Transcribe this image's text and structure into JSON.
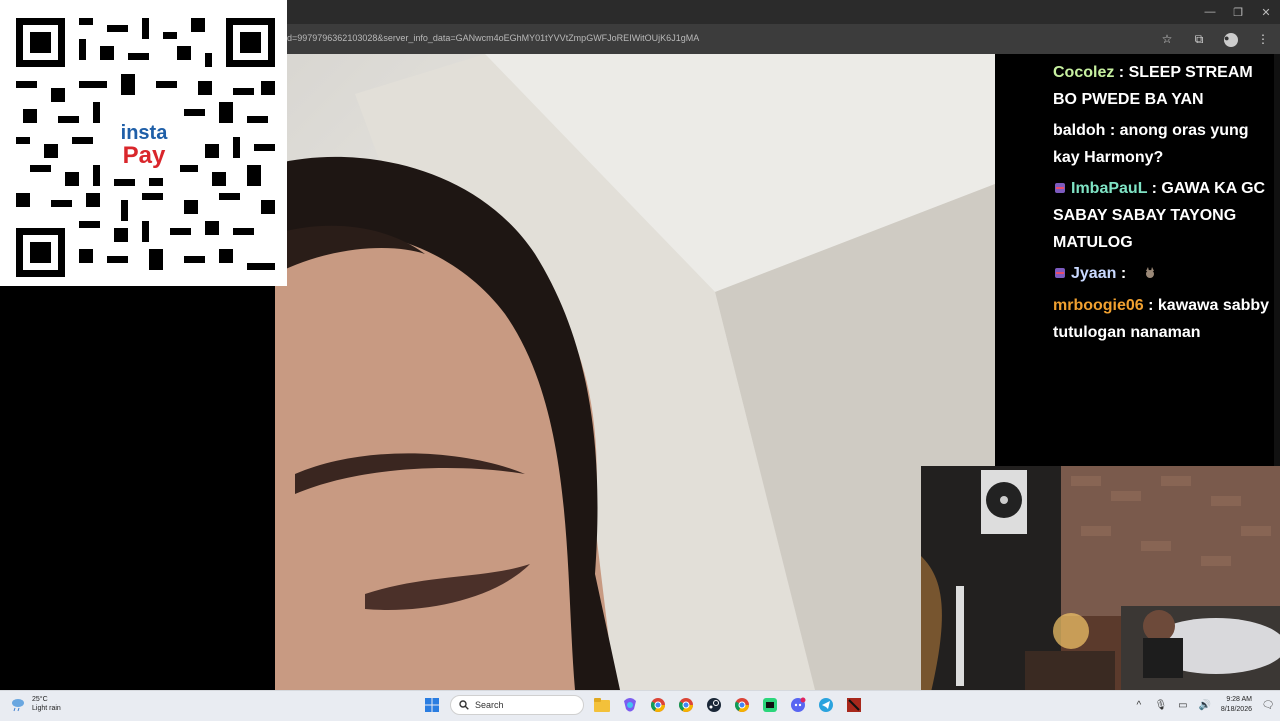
{
  "browser": {
    "url": "d=9979796362103028&server_info_data=GANwcm4oEGhMY01tYVVtZmpGWFJoREIWitOUjK6J1gMA",
    "window_controls": [
      "minimize-icon",
      "restore-icon",
      "close-icon"
    ]
  },
  "qr_overlay": {
    "logo_line1": "insta",
    "logo_line2": "Pay"
  },
  "chat": {
    "messages": [
      {
        "user": "Cocolez",
        "user_color": "#c7f0a0",
        "sep": " : ",
        "text": "SLEEP STREAM BO PWEDE BA YAN",
        "badge": ""
      },
      {
        "user": "baldoh",
        "user_color": "#ffffff",
        "sep": " : ",
        "text": "anong oras yung kay Harmony?",
        "badge": ""
      },
      {
        "user": "ImbaPauL",
        "user_color": "#7fe3c4",
        "sep": " : ",
        "text": "GAWA KA GC SABAY SABAY TAYONG MATULOG",
        "badge": "ninja-badge-icon"
      },
      {
        "user": "Jyaan",
        "user_color": "#c9d9ff",
        "sep": " : ",
        "text": "",
        "badge": "ninja-badge-icon",
        "emote": "cat-emote-icon"
      },
      {
        "user": "mrboogie06",
        "user_color": "#f0a030",
        "sep": " : ",
        "text": "kawawa sabby tutulogan nanaman",
        "badge": ""
      }
    ]
  },
  "taskbar": {
    "weather_temp": "25°C",
    "weather_desc": "Light rain",
    "search_placeholder": "Search",
    "time": "9:28 AM",
    "date": "8/18/2026",
    "apps": [
      "windows-start-icon",
      "file-explorer-icon",
      "copilot-icon",
      "chrome-icon",
      "chrome-icon",
      "steam-icon",
      "chrome-icon",
      "app-icon",
      "discord-icon",
      "telegram-icon",
      "dota-icon"
    ]
  }
}
